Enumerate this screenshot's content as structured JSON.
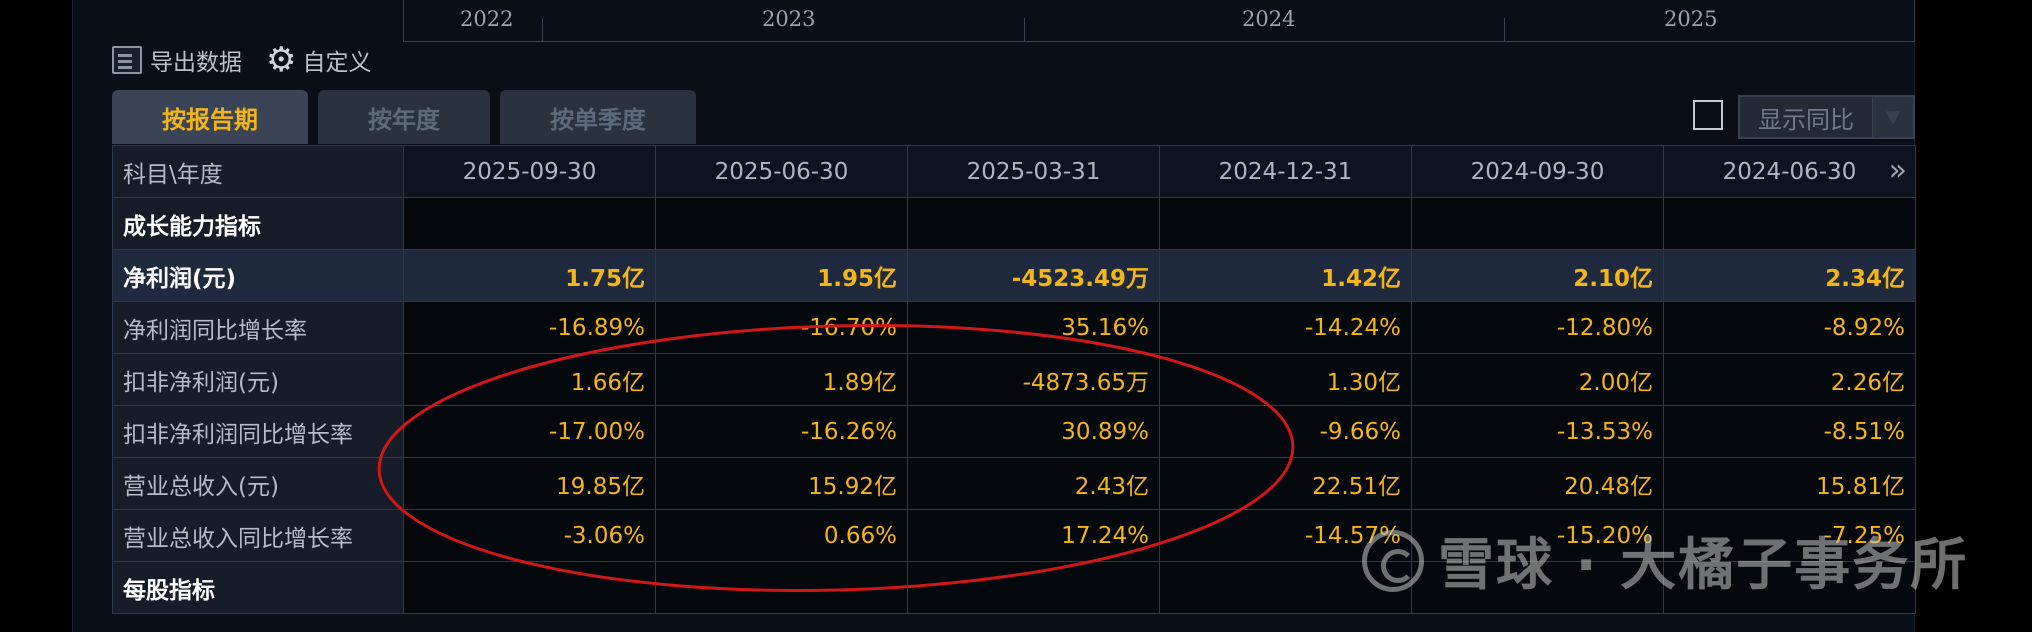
{
  "timeline": {
    "years": [
      "2022",
      "2023",
      "2024",
      "2025"
    ]
  },
  "toolbar": {
    "export_label": "导出数据",
    "customize_label": "自定义"
  },
  "tabs": [
    {
      "label": "按报告期",
      "active": true
    },
    {
      "label": "按年度",
      "active": false
    },
    {
      "label": "按单季度",
      "active": false
    }
  ],
  "yoy_toggle": {
    "label": "显示同比",
    "checked": false
  },
  "table": {
    "corner": "科目\\年度",
    "columns": [
      "2025-09-30",
      "2025-06-30",
      "2025-03-31",
      "2024-12-31",
      "2024-09-30",
      "2024-06-30"
    ],
    "rows": [
      {
        "label": "成长能力指标",
        "type": "section",
        "values": [
          "",
          "",
          "",
          "",
          "",
          ""
        ]
      },
      {
        "label": "净利润(元)",
        "type": "highlight",
        "values": [
          "1.75亿",
          "1.95亿",
          "-4523.49万",
          "1.42亿",
          "2.10亿",
          "2.34亿"
        ]
      },
      {
        "label": "净利润同比增长率",
        "type": "normal",
        "values": [
          "-16.89%",
          "-16.70%",
          "35.16%",
          "-14.24%",
          "-12.80%",
          "-8.92%"
        ]
      },
      {
        "label": "扣非净利润(元)",
        "type": "normal",
        "values": [
          "1.66亿",
          "1.89亿",
          "-4873.65万",
          "1.30亿",
          "2.00亿",
          "2.26亿"
        ]
      },
      {
        "label": "扣非净利润同比增长率",
        "type": "normal",
        "values": [
          "-17.00%",
          "-16.26%",
          "30.89%",
          "-9.66%",
          "-13.53%",
          "-8.51%"
        ]
      },
      {
        "label": "营业总收入(元)",
        "type": "normal",
        "values": [
          "19.85亿",
          "15.92亿",
          "2.43亿",
          "22.51亿",
          "20.48亿",
          "15.81亿"
        ]
      },
      {
        "label": "营业总收入同比增长率",
        "type": "normal",
        "values": [
          "-3.06%",
          "0.66%",
          "17.24%",
          "-14.57%",
          "-15.20%",
          "-7.25%"
        ]
      },
      {
        "label": "每股指标",
        "type": "section",
        "values": [
          "",
          "",
          "",
          "",
          "",
          ""
        ]
      }
    ]
  },
  "watermark": {
    "text": "雪球 · 大橘子事务所"
  },
  "colors": {
    "value": "#f4b617",
    "active_tab": "#f2b51a",
    "annotation": "#d01818"
  }
}
